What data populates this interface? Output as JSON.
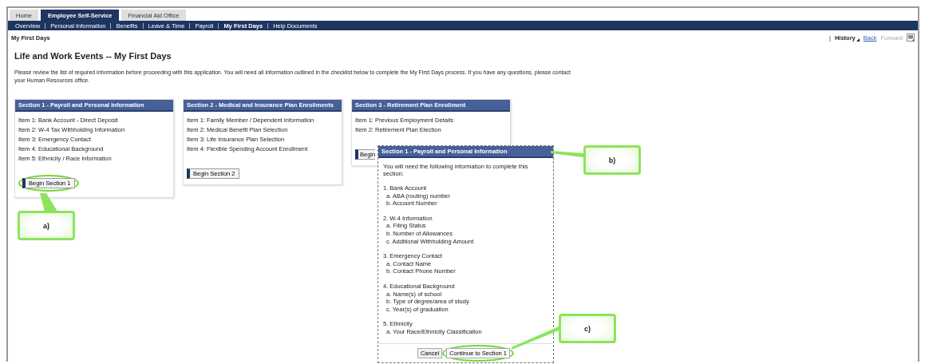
{
  "tabs": [
    {
      "label": "Home",
      "selected": false
    },
    {
      "label": "Employee Self-Service",
      "selected": true
    },
    {
      "label": "Financial Aid Office",
      "selected": false
    }
  ],
  "nav": [
    {
      "label": "Overview",
      "selected": false
    },
    {
      "label": "Personal Information",
      "selected": false
    },
    {
      "label": "Benefits",
      "selected": false
    },
    {
      "label": "Leave & Time",
      "selected": false
    },
    {
      "label": "Payroll",
      "selected": false
    },
    {
      "label": "My First Days",
      "selected": true
    },
    {
      "label": "Help Documents",
      "selected": false
    }
  ],
  "breadcrumb": "My First Days",
  "page_tools": {
    "separator": "|",
    "history": "History",
    "back": {
      "label": "Back",
      "disabled": false
    },
    "forward": {
      "label": "Forward",
      "disabled": true
    }
  },
  "title": "Life and Work Events -- My First Days",
  "intro": "Please review the list of required information before proceeding with this application.  You will need all information outlined in the checklist below to complete the My First Days process.  If you have any questions, please contact your Human Resources office.",
  "sections": [
    {
      "title": "Section 1 - Payroll and Personal Information",
      "items": [
        "Item 1:  Bank Account - Direct Deposit",
        "Item 2:  W-4 Tax Withholding Information",
        "Item 3:  Emergency Contact",
        "Item 4:  Educational Background",
        "Item 5:  Ethnicity / Race Information"
      ],
      "button": "Begin Section 1",
      "highlighted": true
    },
    {
      "title": "Section 2 - Medical and Insurance Plan Enrollments",
      "items": [
        "Item 1:  Family Member / Dependent Information",
        "Item 2:  Medical Benefit Plan Selection",
        "Item 3:  Life Insurance Plan Selection",
        "Item 4:  Flexible Spending Account Enrollment"
      ],
      "button": "Begin Section 2",
      "highlighted": false
    },
    {
      "title": "Section 3 - Retirement Plan Enrollment",
      "items": [
        "Item 1:  Previous Employment Details",
        "Item 2:  Retirement Plan Election"
      ],
      "button": "Begin",
      "highlighted": false
    }
  ],
  "popup": {
    "title": "Section 1 - Payroll and Personal Information",
    "intro": "You will need the following information to complete this section:",
    "groups": [
      {
        "heading": "1. Bank Account",
        "items": [
          "a. ABA (routing) number",
          "b. Account Number"
        ]
      },
      {
        "heading": "2. W-4 Information",
        "items": [
          "a. Filing Status",
          "b. Number of Allowances",
          "c. Additional Withholding Amount"
        ]
      },
      {
        "heading": "3. Emergency Contact",
        "items": [
          "a. Contact Name",
          "b. Contact Phone Number"
        ]
      },
      {
        "heading": "4. Educational Background",
        "items": [
          "a. Name(s) of school",
          "b. Type of degree/area of study",
          "c. Year(s) of graduation"
        ]
      },
      {
        "heading": "5. Ethnicity",
        "items": [
          "a. Your Race/Ethnicity Classificaiton"
        ]
      }
    ],
    "buttons": [
      {
        "label": "Cancel",
        "kind": "cancel",
        "highlighted": false
      },
      {
        "label": "Continue to Section 1",
        "kind": "continue",
        "highlighted": true
      }
    ]
  },
  "callouts": [
    {
      "label": "a)"
    },
    {
      "label": "b)"
    },
    {
      "label": "c)"
    }
  ]
}
